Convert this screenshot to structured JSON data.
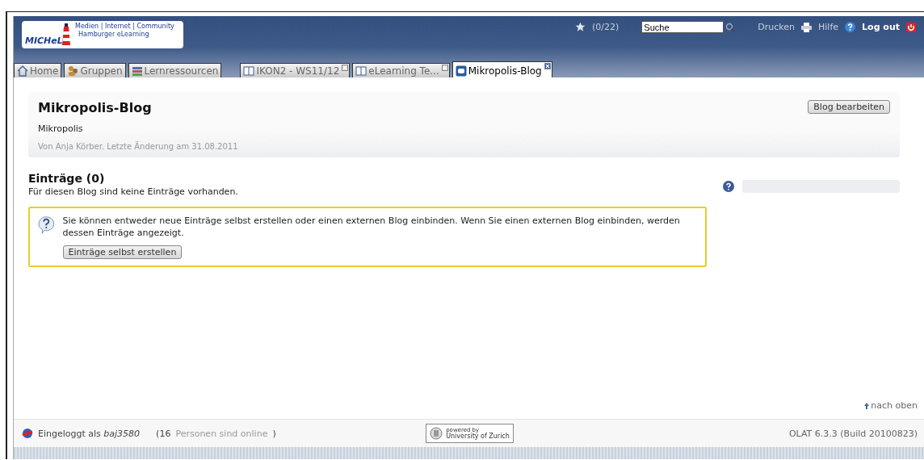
{
  "header": {
    "logo": {
      "tagline_1": "Medien | Internet | Community",
      "tagline_2": "Hamburger eLearning",
      "brand": "MICHeL"
    },
    "bookmarks": "(0/22)",
    "search": {
      "value": "Suche"
    },
    "print": "Drucken",
    "help": "Hilfe",
    "logout": "Log out"
  },
  "tabs": [
    {
      "label": "Home",
      "kind": "home",
      "selected": false,
      "closable": false
    },
    {
      "label": "Gruppen",
      "kind": "groups",
      "selected": false,
      "closable": false
    },
    {
      "label": "Lernressourcen",
      "kind": "resources",
      "selected": false,
      "closable": false
    },
    {
      "label": "IKON2 - WS11/12",
      "kind": "course",
      "selected": false,
      "closable": true
    },
    {
      "label": "eLearning Te...",
      "kind": "course",
      "selected": false,
      "closable": true
    },
    {
      "label": "Mikropolis-Blog",
      "kind": "blog",
      "selected": true,
      "closable": true
    }
  ],
  "blog": {
    "title": "Mikropolis-Blog",
    "subtitle": "Mikropolis",
    "meta": "Von Anja Körber. Letzte Änderung am 31.08.2011",
    "edit_button": "Blog bearbeiten"
  },
  "entries": {
    "heading": "Einträge (0)",
    "empty": "Für diesen Blog sind keine Einträge vorhanden.",
    "info": "Sie können entweder neue Einträge selbst erstellen oder einen externen Blog einbinden. Wenn Sie einen externen Blog einbinden, werden dessen Einträge angezeigt.",
    "create_button": "Einträge selbst erstellen"
  },
  "to_top": "nach oben",
  "footer": {
    "logged_in": "Eingeloggt als *baj3580*",
    "online_prefix": "(16",
    "online_link": "Personen sind online",
    "online_suffix": ")",
    "powered_1": "powered by",
    "powered_2": "University of Zurich",
    "version": "OLAT 6.3.3 (Build 20100823)"
  }
}
